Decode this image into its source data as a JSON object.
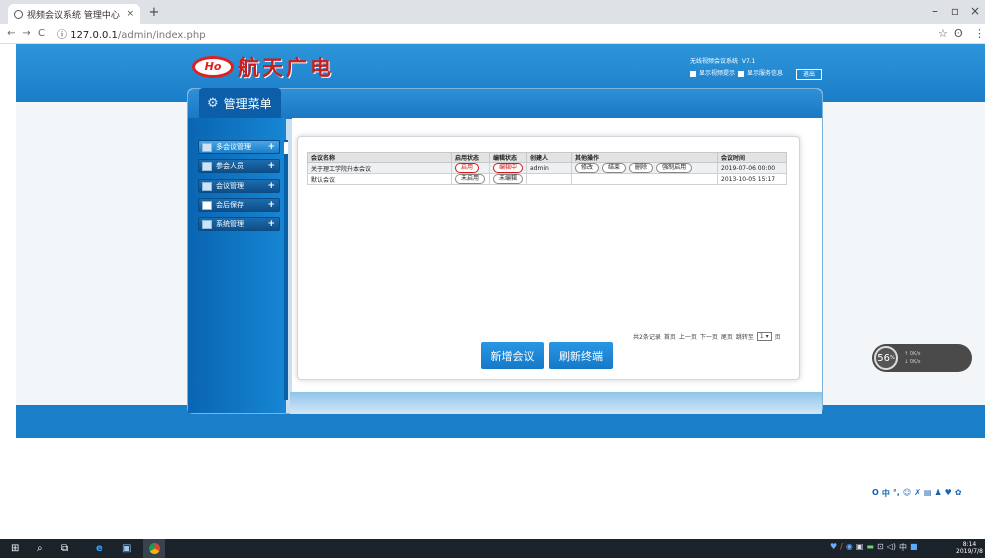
{
  "browser": {
    "tab_title": "视频会议系统 管理中心",
    "tab_close": "×",
    "new_tab": "+",
    "url_host": "127.0.0.1",
    "url_path": "/admin/index.php",
    "back": "←",
    "forward": "→",
    "reload": "C",
    "info": "ⓘ",
    "star": "☆",
    "profile": "ʘ",
    "more": "⋮",
    "min": "–",
    "max": "▫",
    "close": "×"
  },
  "header": {
    "logo_mark": "Ho",
    "logo_text": "航天广电",
    "system_name": "无线视频会议系统",
    "version": "V7.1",
    "show_stream_hint": "显示视频提示",
    "show_server_info": "显示服务信息",
    "logout": "退出"
  },
  "menu": {
    "title": "管理菜单",
    "items": [
      {
        "label": "多会议管理",
        "plus": "+"
      },
      {
        "label": "参会人员",
        "plus": "+"
      },
      {
        "label": "会议管理",
        "plus": "+"
      },
      {
        "label": "会后保存",
        "plus": "+"
      },
      {
        "label": "系统管理",
        "plus": "+"
      }
    ]
  },
  "table": {
    "columns": [
      "会议名称",
      "启用状态",
      "编辑状态",
      "创建人",
      "其他操作",
      "会议时间"
    ],
    "rows": [
      {
        "name": "关于理工学院升本会议",
        "enable": "启用",
        "edit": "编辑中",
        "creator": "admin",
        "ops": [
          "修改",
          "结束",
          "删除",
          "强制启用"
        ],
        "time": "2019-07-06 00:00"
      },
      {
        "name": "默认会议",
        "enable": "未启用",
        "edit": "未编辑",
        "creator": "",
        "ops": [],
        "time": "2013-10-05 15:17"
      }
    ]
  },
  "pager": {
    "summary": "共2条记录",
    "first": "首页",
    "prev": "上一页",
    "next": "下一页",
    "last": "尾页",
    "goto": "跳转至",
    "page_value": "1",
    "page_unit": "页"
  },
  "buttons": {
    "add_meeting": "新增会议",
    "refresh_terminal": "刷新终端"
  },
  "widget": {
    "speed": "56",
    "unit": "%",
    "up": "0K/s",
    "down": "0K/s"
  },
  "sogou": [
    "O",
    "中",
    "°,",
    "☺",
    "✗",
    "▤",
    "♟",
    "♥",
    "✿"
  ],
  "taskbar": {
    "clock_time": "8:14",
    "clock_date": "2019/7/8",
    "ime": "中"
  }
}
